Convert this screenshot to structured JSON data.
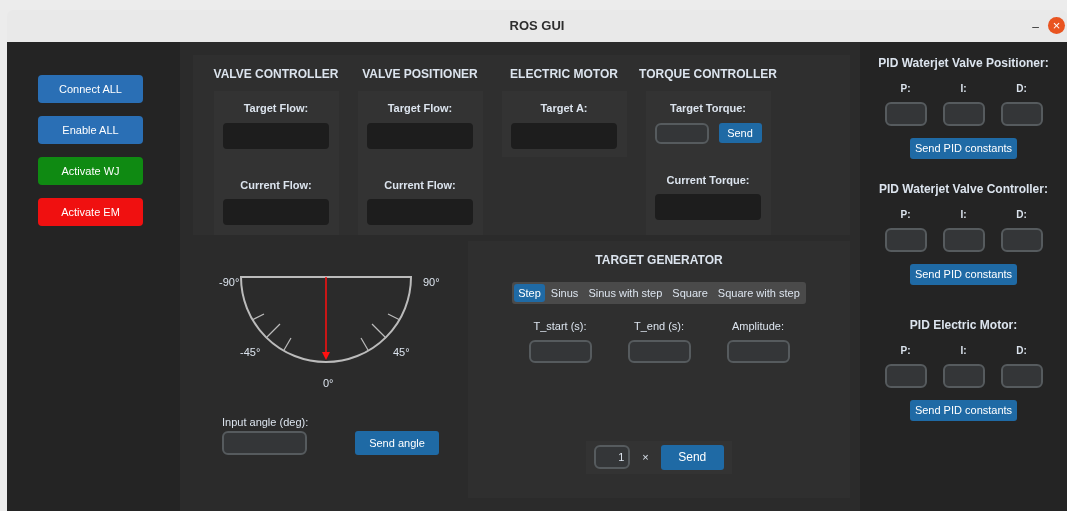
{
  "window": {
    "title": "ROS GUI",
    "minimize": "–",
    "close": "×"
  },
  "left_buttons": [
    {
      "label": "Connect ALL",
      "color": "#2a6fb5"
    },
    {
      "label": "Enable ALL",
      "color": "#2a6fb5"
    },
    {
      "label": "Activate WJ",
      "color": "#0f8a12"
    },
    {
      "label": "Activate EM",
      "color": "#f01010"
    }
  ],
  "modules": [
    {
      "title": "VALVE CONTROLLER",
      "fields": [
        {
          "label": "Target Flow:",
          "kind": "display"
        },
        {
          "label": "Current Flow:",
          "kind": "display"
        }
      ]
    },
    {
      "title": "VALVE POSITIONER",
      "fields": [
        {
          "label": "Target Flow:",
          "kind": "display"
        },
        {
          "label": "Current Flow:",
          "kind": "display"
        }
      ]
    },
    {
      "title": "ELECTRIC MOTOR",
      "fields": [
        {
          "label": "Target A:",
          "kind": "display"
        }
      ]
    },
    {
      "title": "TORQUE CONTROLLER",
      "fields": [
        {
          "label": "Target Torque:",
          "kind": "input_send",
          "button": "Send"
        },
        {
          "label": "Current Torque:",
          "kind": "display"
        }
      ]
    }
  ],
  "angle_gauge": {
    "left_label": "-90°",
    "right_label": "90°",
    "lower_left_label": "-45°",
    "lower_right_label": "45°",
    "bottom_label": "0°",
    "input_label": "Input angle (deg):",
    "send_button": "Send angle"
  },
  "target_generator": {
    "title": "TARGET GENERATOR",
    "modes": [
      {
        "label": "Step",
        "selected": true
      },
      {
        "label": "Sinus",
        "selected": false
      },
      {
        "label": "Sinus with step",
        "selected": false
      },
      {
        "label": "Square",
        "selected": false
      },
      {
        "label": "Square with step",
        "selected": false
      }
    ],
    "params": [
      {
        "label": "T_start (s):"
      },
      {
        "label": "T_end (s):"
      },
      {
        "label": "Amplitude:"
      }
    ],
    "count": "1",
    "multiply": "×",
    "send_button": "Send"
  },
  "pid_sections": [
    {
      "title": "PID Waterjet Valve Positioner:",
      "gains": [
        "P:",
        "I:",
        "D:"
      ],
      "button": "Send PID constants"
    },
    {
      "title": "PID Waterjet Valve Controller:",
      "gains": [
        "P:",
        "I:",
        "D:"
      ],
      "button": "Send PID constants"
    },
    {
      "title": "PID Electric Motor:",
      "gains": [
        "P:",
        "I:",
        "D:"
      ],
      "button": "Send PID constants"
    }
  ]
}
